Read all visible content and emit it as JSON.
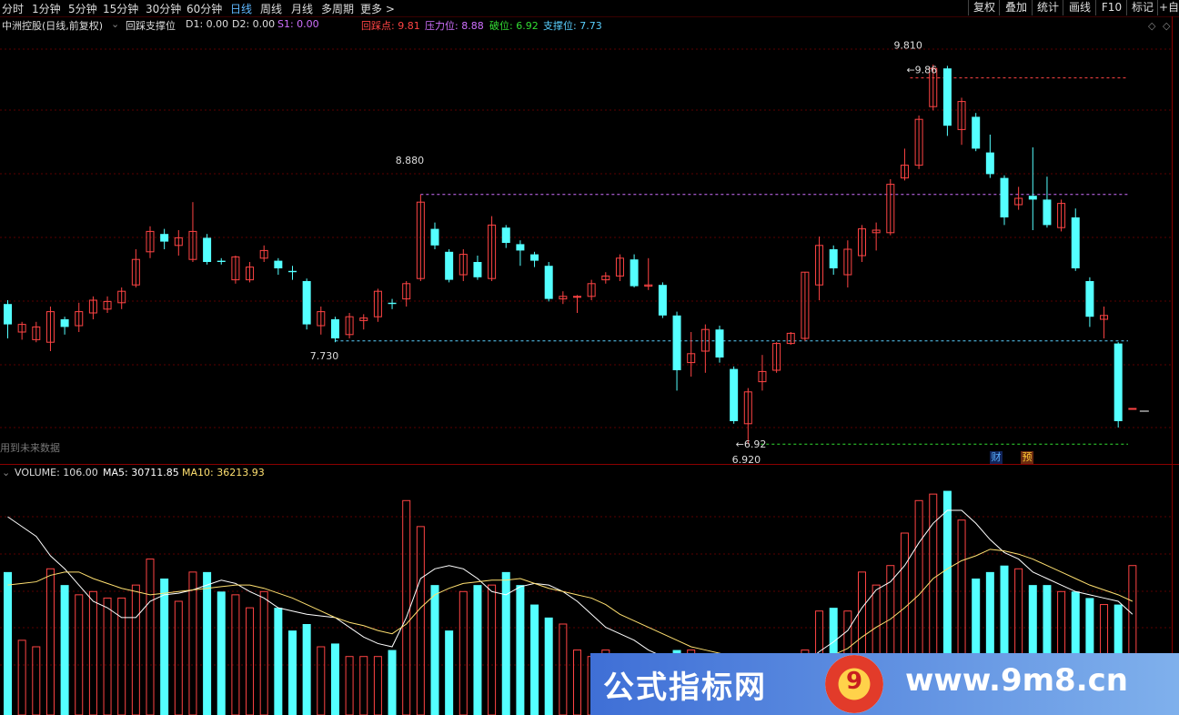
{
  "toolbar": {
    "periods": [
      "分时",
      "1分钟",
      "5分钟",
      "15分钟",
      "30分钟",
      "60分钟",
      "日线",
      "周线",
      "月线",
      "多周期",
      "更多 >"
    ],
    "active": "日线",
    "right_buttons": [
      "复权",
      "叠加",
      "统计",
      "画线",
      "F10",
      "标记",
      "+自"
    ]
  },
  "info": {
    "title": "中洲控股(日线,前复权)",
    "indicator": "回踩支撑位",
    "d1": "D1: 0.00",
    "d2": "D2: 0.00",
    "s1": "S1: 0.00",
    "huicai": "回踩点: 9.81",
    "yali": "压力位: 8.88",
    "powei": "破位: 6.92",
    "zhicheng": "支撑位: 7.73"
  },
  "volume_info": {
    "volume": "VOLUME: 106.00",
    "ma5": "MA5: 30711.85",
    "ma10": "MA10: 36213.93"
  },
  "notes": {
    "future": "用到未来数据",
    "cai": "财",
    "yu": "预"
  },
  "watermark": {
    "left": "公式指标网",
    "logo": "9",
    "right": "www.9m8.cn"
  },
  "colors": {
    "up": "#ff4444",
    "down": "#54ffff",
    "yali_line": "#d070ff",
    "zhicheng_line": "#5ad0ff",
    "powei_line": "#33dd33",
    "huicai_line": "#ff4444",
    "ma5": "#ffffff",
    "ma10": "#ffe070"
  },
  "chart_data": {
    "type": "candlestick",
    "price_range": [
      6.8,
      10.15
    ],
    "levels": {
      "huicai": 9.81,
      "yali": 8.88,
      "zhicheng": 7.73,
      "powei": 6.92
    },
    "annotations": [
      {
        "text": "9.810",
        "at_bar": 63,
        "price": 9.81
      },
      {
        "text": "8.880",
        "at_bar": 28,
        "price": 8.88
      },
      {
        "text": "7.730",
        "at_bar": 22,
        "price": 7.73
      },
      {
        "text": "←9.86",
        "at_bar": 63,
        "price": 9.86
      },
      {
        "text": "←6.92",
        "at_bar": 51,
        "price": 6.92
      },
      {
        "text": "6.920",
        "at_bar": 51,
        "price": 6.83
      }
    ],
    "candles": [
      [
        8.02,
        7.86,
        7.75,
        8.05
      ],
      [
        7.8,
        7.86,
        7.74,
        7.88
      ],
      [
        7.74,
        7.84,
        7.72,
        7.88
      ],
      [
        7.72,
        7.96,
        7.65,
        8.0
      ],
      [
        7.9,
        7.84,
        7.78,
        7.92
      ],
      [
        7.85,
        7.96,
        7.8,
        8.03
      ],
      [
        7.95,
        8.05,
        7.9,
        8.08
      ],
      [
        7.98,
        8.04,
        7.95,
        8.08
      ],
      [
        8.03,
        8.12,
        7.98,
        8.15
      ],
      [
        8.17,
        8.37,
        8.15,
        8.45
      ],
      [
        8.43,
        8.59,
        8.38,
        8.63
      ],
      [
        8.57,
        8.51,
        8.45,
        8.61
      ],
      [
        8.48,
        8.54,
        8.4,
        8.6
      ],
      [
        8.37,
        8.59,
        8.35,
        8.82
      ],
      [
        8.54,
        8.35,
        8.33,
        8.57
      ],
      [
        8.36,
        8.35,
        8.33,
        8.38
      ],
      [
        8.21,
        8.39,
        8.18,
        8.4
      ],
      [
        8.21,
        8.31,
        8.19,
        8.35
      ],
      [
        8.38,
        8.44,
        8.35,
        8.48
      ],
      [
        8.36,
        8.3,
        8.25,
        8.38
      ],
      [
        8.28,
        8.27,
        8.21,
        8.32
      ],
      [
        8.2,
        7.86,
        7.82,
        8.22
      ],
      [
        7.85,
        7.96,
        7.78,
        8.0
      ],
      [
        7.9,
        7.75,
        7.72,
        7.92
      ],
      [
        7.78,
        7.92,
        7.75,
        7.95
      ],
      [
        7.89,
        7.91,
        7.82,
        7.94
      ],
      [
        7.92,
        8.12,
        7.88,
        8.14
      ],
      [
        8.03,
        8.02,
        7.98,
        8.06
      ],
      [
        8.06,
        8.18,
        8.0,
        8.2
      ],
      [
        8.22,
        8.82,
        8.2,
        8.88
      ],
      [
        8.61,
        8.48,
        8.45,
        8.66
      ],
      [
        8.43,
        8.21,
        8.19,
        8.45
      ],
      [
        8.25,
        8.41,
        8.2,
        8.45
      ],
      [
        8.35,
        8.23,
        8.21,
        8.4
      ],
      [
        8.22,
        8.64,
        8.2,
        8.71
      ],
      [
        8.62,
        8.5,
        8.46,
        8.64
      ],
      [
        8.49,
        8.44,
        8.32,
        8.52
      ],
      [
        8.41,
        8.36,
        8.31,
        8.43
      ],
      [
        8.32,
        8.06,
        8.04,
        8.35
      ],
      [
        8.06,
        8.08,
        8.02,
        8.12
      ],
      [
        8.08,
        8.08,
        7.95,
        8.09
      ],
      [
        8.08,
        8.18,
        8.05,
        8.21
      ],
      [
        8.21,
        8.24,
        8.18,
        8.27
      ],
      [
        8.24,
        8.38,
        8.2,
        8.41
      ],
      [
        8.37,
        8.16,
        8.15,
        8.41
      ],
      [
        8.16,
        8.17,
        8.13,
        8.38
      ],
      [
        8.17,
        7.93,
        7.91,
        8.19
      ],
      [
        7.93,
        7.5,
        7.34,
        7.96
      ],
      [
        7.56,
        7.63,
        7.45,
        7.8
      ],
      [
        7.65,
        7.82,
        7.48,
        7.86
      ],
      [
        7.82,
        7.6,
        7.56,
        7.85
      ],
      [
        7.51,
        7.1,
        7.08,
        7.53
      ],
      [
        7.08,
        7.33,
        6.92,
        7.36
      ],
      [
        7.41,
        7.49,
        7.34,
        7.62
      ],
      [
        7.5,
        7.71,
        7.48,
        7.72
      ],
      [
        7.71,
        7.79,
        7.7,
        7.8
      ],
      [
        7.75,
        8.27,
        7.73,
        8.27
      ],
      [
        8.17,
        8.48,
        8.05,
        8.55
      ],
      [
        8.45,
        8.3,
        8.25,
        8.48
      ],
      [
        8.25,
        8.45,
        8.15,
        8.52
      ],
      [
        8.4,
        8.61,
        8.35,
        8.64
      ],
      [
        8.58,
        8.6,
        8.44,
        8.66
      ],
      [
        8.58,
        8.96,
        8.56,
        9.0
      ],
      [
        9.01,
        9.11,
        8.99,
        9.24
      ],
      [
        9.11,
        9.47,
        9.08,
        9.5
      ],
      [
        9.57,
        9.87,
        9.54,
        9.9
      ],
      [
        9.87,
        9.42,
        9.34,
        9.89
      ],
      [
        9.39,
        9.61,
        9.27,
        9.64
      ],
      [
        9.49,
        9.24,
        9.22,
        9.52
      ],
      [
        9.21,
        9.04,
        9.01,
        9.35
      ],
      [
        9.01,
        8.7,
        8.64,
        9.03
      ],
      [
        8.8,
        8.85,
        8.76,
        8.94
      ],
      [
        8.87,
        8.84,
        8.6,
        9.25
      ],
      [
        8.84,
        8.64,
        8.62,
        9.02
      ],
      [
        8.62,
        8.81,
        8.59,
        8.84
      ],
      [
        8.7,
        8.3,
        8.28,
        8.77
      ],
      [
        8.2,
        7.92,
        7.84,
        8.23
      ],
      [
        7.9,
        7.93,
        7.75,
        8.0
      ],
      [
        7.71,
        7.1,
        7.05,
        7.72
      ],
      [
        7.2,
        7.2,
        7.2,
        7.2
      ]
    ],
    "volumes": [
      44000,
      23000,
      21000,
      45000,
      40000,
      37000,
      38000,
      36000,
      36000,
      40000,
      48000,
      42000,
      35000,
      44000,
      44000,
      38000,
      37000,
      33000,
      38000,
      33000,
      26000,
      28000,
      21000,
      22000,
      18000,
      18000,
      18000,
      20000,
      66000,
      58000,
      40000,
      26000,
      38000,
      40000,
      40000,
      44000,
      40000,
      34000,
      30000,
      28000,
      20000,
      18000,
      20000,
      15000,
      12000,
      12000,
      12000,
      20000,
      20000,
      15000,
      15000,
      15000,
      15000,
      15000,
      15000,
      15000,
      20000,
      32000,
      33000,
      32000,
      44000,
      40000,
      46000,
      56000,
      66000,
      68000,
      69000,
      60000,
      42000,
      44000,
      46000,
      45000,
      40000,
      40000,
      38000,
      38000,
      36000,
      34000,
      34000,
      46000
    ],
    "ma5": [
      61000,
      58000,
      55000,
      49000,
      45000,
      40000,
      35000,
      33000,
      30000,
      30000,
      35000,
      37000,
      37500,
      38500,
      40000,
      41500,
      40500,
      38000,
      36000,
      33000,
      32000,
      31000,
      30500,
      30000,
      27000,
      24000,
      22000,
      21000,
      30000,
      42000,
      45000,
      46000,
      45000,
      42000,
      38000,
      37000,
      39500,
      40500,
      40000,
      38000,
      35000,
      31000,
      27000,
      25000,
      23000,
      20000,
      18000,
      18000,
      18000,
      17000,
      16000,
      16000,
      16000,
      15500,
      15000,
      15000,
      16000,
      19500,
      22500,
      26000,
      33000,
      38500,
      41000,
      46000,
      53000,
      59000,
      63000,
      63000,
      59000,
      54000,
      50000,
      48000,
      44000,
      42000,
      40000,
      38000,
      37000,
      36000,
      35000,
      31000
    ],
    "ma10": [
      40000,
      40500,
      41000,
      43000,
      44000,
      44000,
      42000,
      40500,
      39000,
      38000,
      37000,
      37500,
      38000,
      38500,
      39000,
      39500,
      40000,
      40000,
      39000,
      37500,
      36000,
      34000,
      32000,
      30000,
      28500,
      27500,
      26000,
      25000,
      28000,
      33000,
      37000,
      39000,
      40500,
      41000,
      41500,
      41500,
      42000,
      40500,
      39000,
      38000,
      37000,
      36000,
      34000,
      31000,
      29000,
      27000,
      25000,
      23000,
      21000,
      20000,
      19000,
      18000,
      17500,
      17000,
      16500,
      16000,
      16000,
      17000,
      18500,
      20500,
      24000,
      27000,
      29500,
      33000,
      37000,
      42000,
      45000,
      47500,
      49000,
      51000,
      50500,
      49500,
      48000,
      46000,
      44000,
      42000,
      40000,
      38500,
      37000,
      35000
    ]
  }
}
